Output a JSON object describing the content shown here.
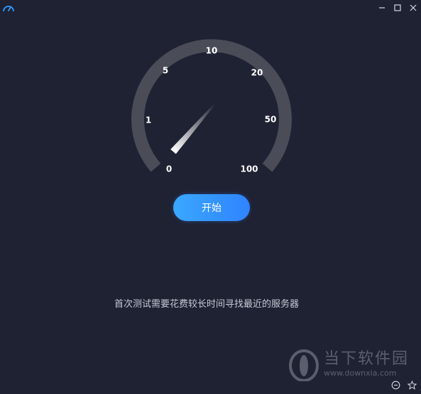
{
  "window": {
    "icon": "speedometer-icon",
    "controls": [
      "minimize-icon",
      "maximize-icon",
      "close-icon"
    ]
  },
  "gauge": {
    "tick_labels": [
      "0",
      "1",
      "5",
      "10",
      "20",
      "50",
      "100"
    ],
    "current_value": 0,
    "track_color": "#4a4c57",
    "needle_color": "#ffffff"
  },
  "start_button": {
    "label": "开始",
    "color": "#2f8cff"
  },
  "hint": {
    "text": "首次测试需要花费较长时间寻找最近的服务器"
  },
  "watermark": {
    "title": "当下软件园",
    "url": "www.downxia.com"
  },
  "footer": {
    "icons": [
      "minus-circle-icon",
      "star-icon"
    ]
  }
}
